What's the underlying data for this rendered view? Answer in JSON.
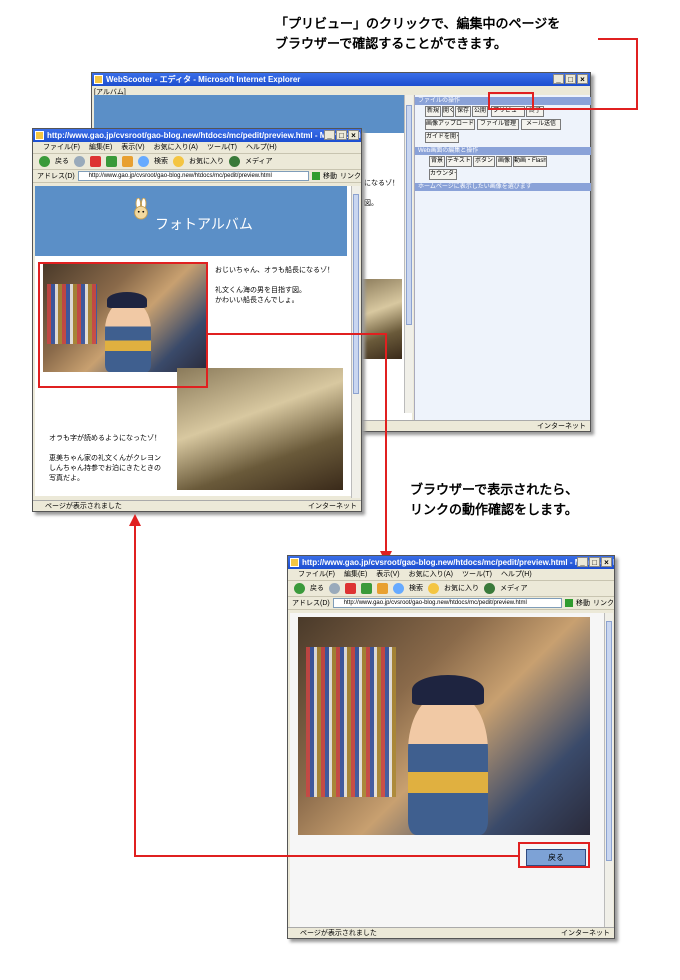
{
  "callouts": {
    "top": "「プリビュー」のクリックで、編集中のページを\nブラウザーで確認することができます。",
    "middle": "ブラウザーで表示されたら、\nリンクの動作確認をします。"
  },
  "editor_window": {
    "title": "WebScooter - エディタ - Microsoft Internet Explorer",
    "breadcrumb": "[アルバム]",
    "file_panel": {
      "heading": "ファイルの操作",
      "buttons": [
        "新規",
        "開く",
        "保存",
        "公開",
        "プリビュー",
        "終了"
      ],
      "buttons_row2": [
        "画像アップロード",
        "ファイル管理",
        "メール送信"
      ],
      "buttons_row3": [
        "ガイドを開く"
      ]
    },
    "edit_panel": {
      "heading": "Web画面の編集と操作",
      "buttons": [
        "背景",
        "テキスト",
        "ボタン",
        "画像",
        "動画・Flash"
      ],
      "buttons_row2": [
        "カウンター"
      ]
    },
    "image_panel": {
      "heading": "ホームページに表示したい画像を選びます"
    },
    "partial_text_1": "になるゾ！",
    "partial_text_2": "図。",
    "status_zone": "インターネット"
  },
  "preview_window_1": {
    "title": "http://www.gao.jp/cvsroot/gao-blog.new/htdocs/mc/pedit/preview.html - Microsoft Internet Ex...",
    "menu": [
      "ファイル(F)",
      "編集(E)",
      "表示(V)",
      "お気に入り(A)",
      "ツール(T)",
      "ヘルプ(H)"
    ],
    "toolbar": [
      "戻る",
      "検索",
      "お気に入り",
      "メディア"
    ],
    "address_label": "アドレス(D)",
    "address": "http://www.gao.jp/cvsroot/gao-blog.new/htdocs/mc/pedit/preview.html",
    "go_label": "移動",
    "links_label": "リンク",
    "banner_title": "フォトアルバム",
    "text1": "おじいちゃん、オラも船長になるゾ！\n\n礼文くん海の男を目指す図。\nかわいい船長さんでしょ。",
    "text2": "オラも字が読めるようになったゾ！\n\n恵美ちゃん家の礼文くんがクレヨン\nしんちゃん持参でお泊にきたときの\n写真だよ。",
    "status": "ページが表示されました",
    "status_zone": "インターネット"
  },
  "preview_window_2": {
    "title": "http://www.gao.jp/cvsroot/gao-blog.new/htdocs/mc/pedit/preview.html - Microsoft Internet Ex...",
    "menu": [
      "ファイル(F)",
      "編集(E)",
      "表示(V)",
      "お気に入り(A)",
      "ツール(T)",
      "ヘルプ(H)"
    ],
    "toolbar": [
      "戻る",
      "検索",
      "お気に入り",
      "メディア"
    ],
    "address_label": "アドレス(D)",
    "address": "http://www.gao.jp/cvsroot/gao-blog.new/htdocs/mc/pedit/preview.html",
    "go_label": "移動",
    "links_label": "リンク",
    "back_button": "戻る",
    "status": "ページが表示されました",
    "status_zone": "インターネット"
  },
  "colors": {
    "accent_red": "#e02020",
    "banner_blue": "#5b8fc7",
    "titlebar_blue": "#1c4ed0"
  }
}
